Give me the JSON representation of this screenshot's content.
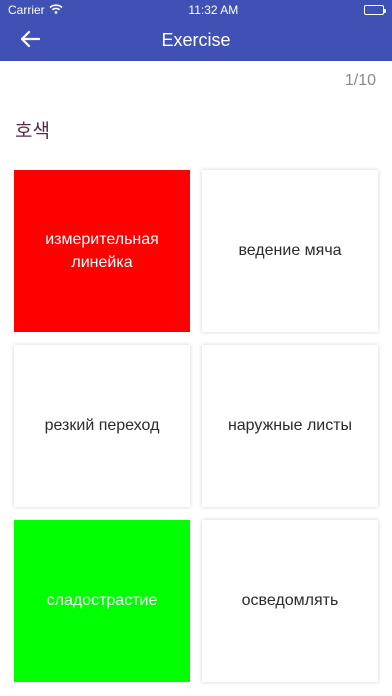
{
  "status_bar": {
    "carrier": "Carrier",
    "time": "11:32 AM"
  },
  "nav": {
    "title": "Exercise",
    "back_icon": "arrow-left-icon",
    "background": "#3f51b5"
  },
  "exercise": {
    "progress": "1/10",
    "question": "호색",
    "options": [
      {
        "label": "измерительная линейка",
        "state": "wrong",
        "color": "#ff0000"
      },
      {
        "label": "ведение мяча",
        "state": "default",
        "color": "#ffffff"
      },
      {
        "label": "резкий переход",
        "state": "default",
        "color": "#ffffff"
      },
      {
        "label": "наружные листы",
        "state": "default",
        "color": "#ffffff"
      },
      {
        "label": "сладострастие",
        "state": "correct",
        "color": "#00ff00"
      },
      {
        "label": "осведомлять",
        "state": "default",
        "color": "#ffffff"
      }
    ]
  }
}
